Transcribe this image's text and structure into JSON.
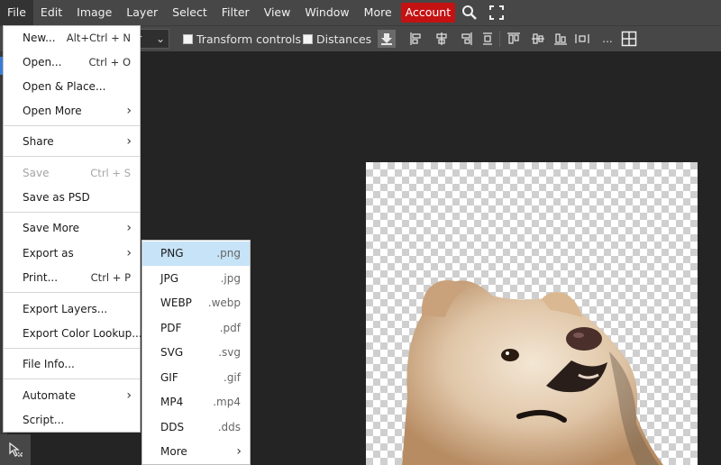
{
  "menubar": {
    "items": [
      "File",
      "Edit",
      "Image",
      "Layer",
      "Select",
      "Filter",
      "View",
      "Window",
      "More"
    ],
    "account": "Account"
  },
  "optionsbar": {
    "blend_partial": "er",
    "transform_controls": "Transform controls",
    "distances": "Distances",
    "more_dots": "..."
  },
  "file_menu": {
    "items": [
      {
        "label": "New...",
        "shortcut": "Alt+Ctrl + N"
      },
      {
        "label": "Open...",
        "shortcut": "Ctrl + O"
      },
      {
        "label": "Open & Place..."
      },
      {
        "label": "Open More",
        "submenu": true
      },
      {
        "label": "Share",
        "submenu": true
      },
      {
        "label": "Save",
        "shortcut": "Ctrl + S",
        "disabled": true
      },
      {
        "label": "Save as PSD"
      },
      {
        "label": "Save More",
        "submenu": true
      },
      {
        "label": "Export as",
        "submenu": true
      },
      {
        "label": "Print...",
        "shortcut": "Ctrl + P"
      },
      {
        "label": "Export Layers..."
      },
      {
        "label": "Export Color Lookup..."
      },
      {
        "label": "File Info..."
      },
      {
        "label": "Automate",
        "submenu": true
      },
      {
        "label": "Script..."
      }
    ]
  },
  "export_menu": {
    "items": [
      {
        "label": "PNG",
        "ext": ".png",
        "highlighted": true
      },
      {
        "label": "JPG",
        "ext": ".jpg"
      },
      {
        "label": "WEBP",
        "ext": ".webp"
      },
      {
        "label": "PDF",
        "ext": ".pdf"
      },
      {
        "label": "SVG",
        "ext": ".svg"
      },
      {
        "label": "GIF",
        "ext": ".gif"
      },
      {
        "label": "MP4",
        "ext": ".mp4"
      },
      {
        "label": "DDS",
        "ext": ".dds"
      },
      {
        "label": "More",
        "submenu": true
      }
    ]
  },
  "colors": {
    "account_bg": "#c41212",
    "menu_highlight": "#c6e3f7",
    "app_bg": "#242424",
    "bar_bg": "#474747"
  }
}
